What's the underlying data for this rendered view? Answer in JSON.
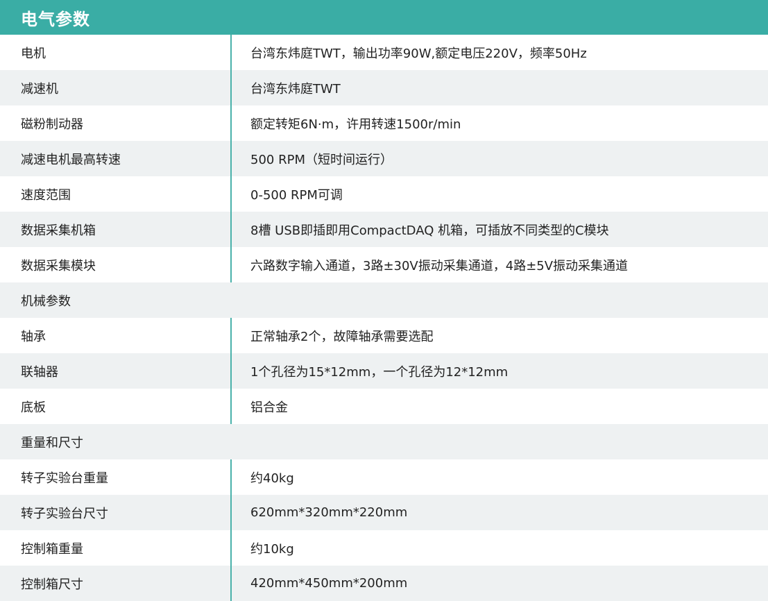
{
  "header": {
    "title": "电气参数"
  },
  "colors": {
    "header_bg": "#3aada5",
    "divider": "#49b1aa",
    "row_alt": "#eef1f2"
  },
  "rows": [
    {
      "label": "电机",
      "value": "台湾东炜庭TWT，输出功率90W,额定电压220V，频率50Hz"
    },
    {
      "label": "减速机",
      "value": "台湾东炜庭TWT"
    },
    {
      "label": "磁粉制动器",
      "value": "额定转矩6N·m，许用转速1500r/min"
    },
    {
      "label": "减速电机最高转速",
      "value": "500 RPM（短时间运行）"
    },
    {
      "label": "速度范围",
      "value": "0-500 RPM可调"
    },
    {
      "label": "数据采集机箱",
      "value": "8槽 USB即插即用CompactDAQ 机箱，可插放不同类型的C模块"
    },
    {
      "label": "数据采集模块",
      "value": "六路数字输入通道，3路±30V振动采集通道，4路±5V振动采集通道"
    },
    {
      "label": "机械参数",
      "section": true
    },
    {
      "label": "轴承",
      "value": "正常轴承2个，故障轴承需要选配"
    },
    {
      "label": "联轴器",
      "value": "1个孔径为15*12mm，一个孔径为12*12mm"
    },
    {
      "label": "底板",
      "value": "铝合金"
    },
    {
      "label": "重量和尺寸",
      "section": true
    },
    {
      "label": "转子实验台重量",
      "value": "约40kg"
    },
    {
      "label": "转子实验台尺寸",
      "value": "620mm*320mm*220mm"
    },
    {
      "label": "控制箱重量",
      "value": "约10kg"
    },
    {
      "label": "控制箱尺寸",
      "value": "420mm*450mm*200mm"
    }
  ]
}
